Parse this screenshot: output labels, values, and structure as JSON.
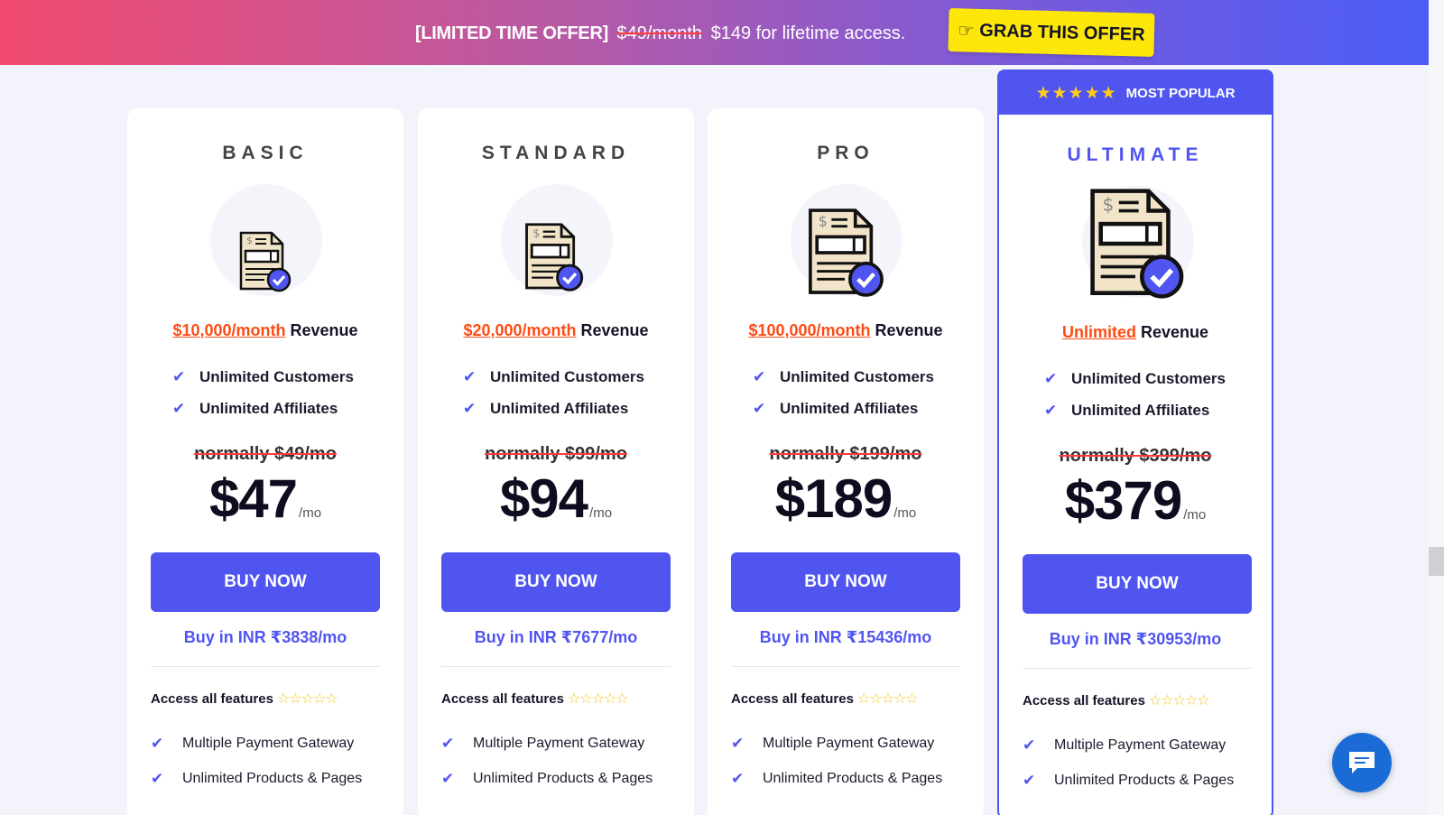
{
  "banner": {
    "tag": "[LIMITED TIME OFFER]",
    "old_price": "$49/month",
    "offer": "$149 for lifetime access.",
    "button_label": "GRAB THIS OFFER",
    "button_icon": "pointing-hand-icon"
  },
  "popular_label": "MOST POPULAR",
  "popular_stars": "★★★★★",
  "revenue_suffix": " Revenue",
  "buy_label": "BUY NOW",
  "access_label": "Access all features",
  "access_stars": "☆☆☆☆☆",
  "per_label": "/mo",
  "check_glyph": "✔",
  "colors": {
    "accent": "#5055f0",
    "revenue_highlight": "#ff4b14",
    "strike": "#ff3b3b",
    "offer_button": "#fde60a",
    "chat": "#1a6bd6"
  },
  "plans": [
    {
      "name": "BASIC",
      "revenue_amount": "$10,000/month",
      "features": [
        "Unlimited Customers",
        "Unlimited Affiliates"
      ],
      "normally": "normally $49/mo",
      "price": "$47",
      "inr": "Buy in INR ₹3838/mo",
      "extra_features": [
        "Multiple Payment Gateway",
        "Unlimited Products & Pages"
      ]
    },
    {
      "name": "STANDARD",
      "revenue_amount": "$20,000/month",
      "features": [
        "Unlimited Customers",
        "Unlimited Affiliates"
      ],
      "normally": "normally $99/mo",
      "price": "$94",
      "inr": "Buy in INR ₹7677/mo",
      "extra_features": [
        "Multiple Payment Gateway",
        "Unlimited Products & Pages"
      ]
    },
    {
      "name": "PRO",
      "revenue_amount": "$100,000/month",
      "features": [
        "Unlimited Customers",
        "Unlimited Affiliates"
      ],
      "normally": "normally $199/mo",
      "price": "$189",
      "inr": "Buy in INR ₹15436/mo",
      "extra_features": [
        "Multiple Payment Gateway",
        "Unlimited Products & Pages"
      ]
    },
    {
      "name": "ULTIMATE",
      "revenue_amount": "Unlimited",
      "features": [
        "Unlimited Customers",
        "Unlimited Affiliates"
      ],
      "normally": "normally $399/mo",
      "price": "$379",
      "inr": "Buy in INR ₹30953/mo",
      "extra_features": [
        "Multiple Payment Gateway",
        "Unlimited Products & Pages"
      ]
    }
  ]
}
